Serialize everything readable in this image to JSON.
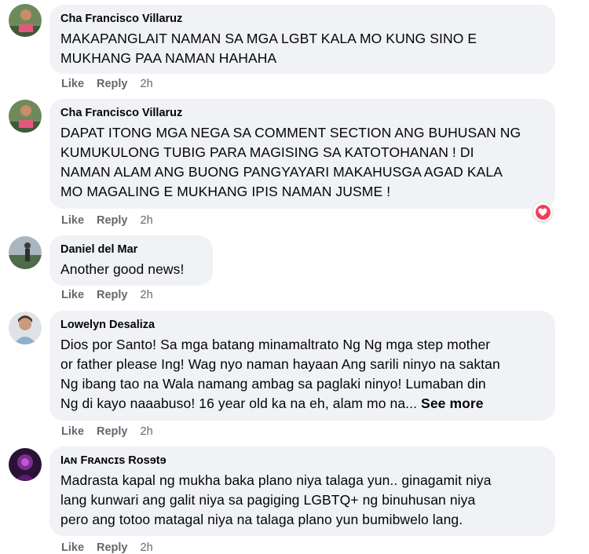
{
  "comments": [
    {
      "name": "Cha Francisco Villaruz",
      "text": "MAKAPANGLAIT NAMAN SA MGA LGBT KALA MO KUNG SINO E\nMUKHANG PAA NAMAN HAHAHA",
      "like": "Like",
      "reply": "Reply",
      "time": "2h"
    },
    {
      "name": "Cha Francisco Villaruz",
      "text": "DAPAT ITONG MGA NEGA SA COMMENT SECTION ANG BUHUSAN NG\nKUMUKULONG TUBIG PARA MAGISING SA KATOTOHANAN ! DI\nNAMAN ALAM ANG BUONG PANGYAYARI MAKAHUSGA AGAD KALA\nMO MAGALING E MUKHANG IPIS NAMAN JUSME !",
      "like": "Like",
      "reply": "Reply",
      "time": "2h",
      "reaction": "heart-reaction"
    },
    {
      "name": "Daniel del Mar",
      "text": "Another good news!",
      "like": "Like",
      "reply": "Reply",
      "time": "2h"
    },
    {
      "name": "Lowelyn Desaliza",
      "text": "Dios por Santo! Sa mga batang minamaltrato Ng Ng mga step mother\nor father please Ing! Wag nyo naman hayaan Ang sarili ninyo na saktan\nNg ibang tao na Wala namang ambag sa paglaki ninyo! Lumaban din\nNg di kayo naaabuso! 16 year old ka na eh, alam mo na...",
      "see_more": "See more",
      "like": "Like",
      "reply": "Reply",
      "time": "2h"
    },
    {
      "name": "Iᴀɴ Fʀᴀɴcɪs Rosɘtɘ",
      "text": "Madrasta kapal ng mukha baka plano niya talaga yun.. ginagamit niya\nlang kunwari ang galit niya sa pagiging LGBTQ+ ng binuhusan niya\npero ang totoo matagal niya na talaga plano yun bumibwelo lang.",
      "like": "Like",
      "reply": "Reply",
      "time": "2h"
    }
  ],
  "colors": {
    "bubble": "#f0f2f5",
    "secondary_text": "#65676b",
    "heart": "#f33e58"
  }
}
